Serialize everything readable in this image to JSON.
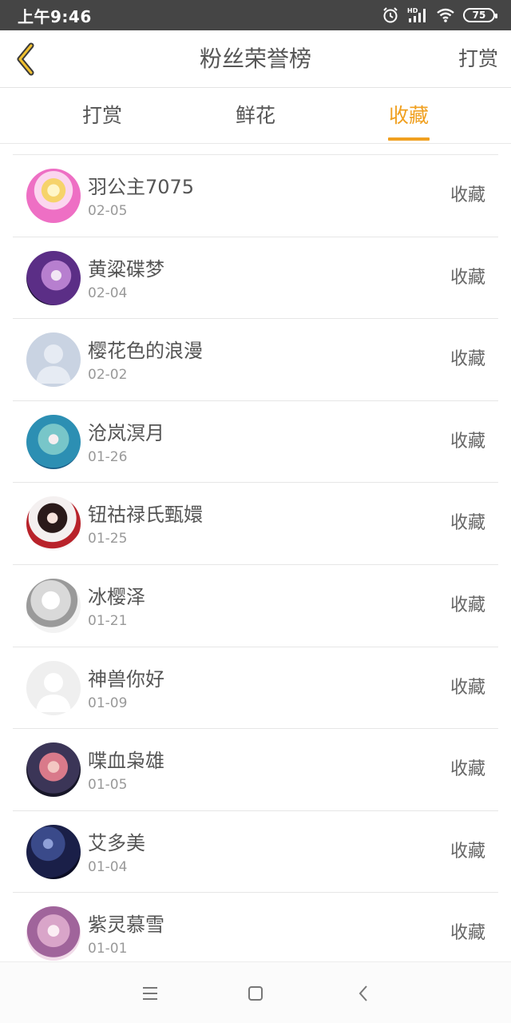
{
  "status_bar": {
    "time": "上午9:46",
    "battery": "75"
  },
  "header": {
    "title": "粉丝荣誉榜",
    "action": "打赏"
  },
  "tabs": [
    {
      "label": "打赏",
      "active": false
    },
    {
      "label": "鲜花",
      "active": false
    },
    {
      "label": "收藏",
      "active": true
    }
  ],
  "colors": {
    "accent": "#f0a020",
    "status_bar": "#454545"
  },
  "fans": [
    {
      "name": "羽公主7075",
      "date": "02-05",
      "action": "收藏",
      "avatar": "anime-avatar-pink"
    },
    {
      "name": "黄粱碟梦",
      "date": "02-04",
      "action": "收藏",
      "avatar": "anime-avatar-purple"
    },
    {
      "name": "樱花色的浪漫",
      "date": "02-02",
      "action": "收藏",
      "avatar": "default-avatar-blue"
    },
    {
      "name": "沧岚溟月",
      "date": "01-26",
      "action": "收藏",
      "avatar": "anime-avatar-teal"
    },
    {
      "name": "钮祜禄氏甄嬛",
      "date": "01-25",
      "action": "收藏",
      "avatar": "anime-avatar-red"
    },
    {
      "name": "冰樱泽",
      "date": "01-21",
      "action": "收藏",
      "avatar": "photo-avatar-white"
    },
    {
      "name": "神兽你好",
      "date": "01-09",
      "action": "收藏",
      "avatar": "default-avatar-gray"
    },
    {
      "name": "喋血枭雄",
      "date": "01-05",
      "action": "收藏",
      "avatar": "anime-avatar-night"
    },
    {
      "name": "艾多美",
      "date": "01-04",
      "action": "收藏",
      "avatar": "galaxy-avatar"
    },
    {
      "name": "紫灵慕雪",
      "date": "01-01",
      "action": "收藏",
      "avatar": "anime-avatar-lilac"
    }
  ]
}
